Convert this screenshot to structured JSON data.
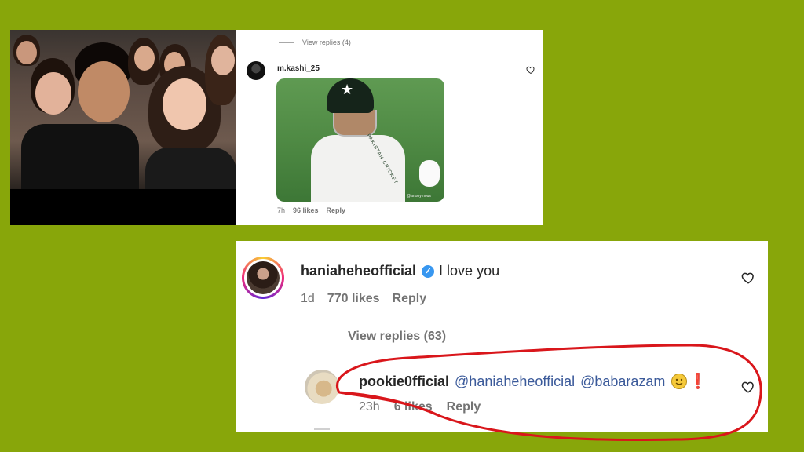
{
  "top_panel": {
    "view_replies": "View replies (4)",
    "comment": {
      "username": "m.kashi_25",
      "gif_jersey_text": "PAKISTAN CRICKET",
      "gif_watermark": "@anonymous",
      "time": "7h",
      "likes": "96 likes",
      "reply": "Reply"
    }
  },
  "bottom_panel": {
    "comment": {
      "username": "haniaheheofficial",
      "verified_mark": "✓",
      "text": "I love you",
      "time": "1d",
      "likes": "770 likes",
      "reply": "Reply"
    },
    "view_replies": "View replies (63)",
    "reply": {
      "username": "pookie0fficial",
      "mention_1": "@haniaheheofficial",
      "mention_2": "@babarazam",
      "emoji_2": "❗",
      "time": "23h",
      "likes": "6 likes",
      "reply": "Reply"
    }
  },
  "colors": {
    "background": "#88a60a",
    "annotation": "#d9161b",
    "verified": "#3897f0",
    "mention": "#3b5a9a"
  },
  "icons": {
    "heart": "heart-outline-icon",
    "verified": "verified-badge-icon"
  }
}
